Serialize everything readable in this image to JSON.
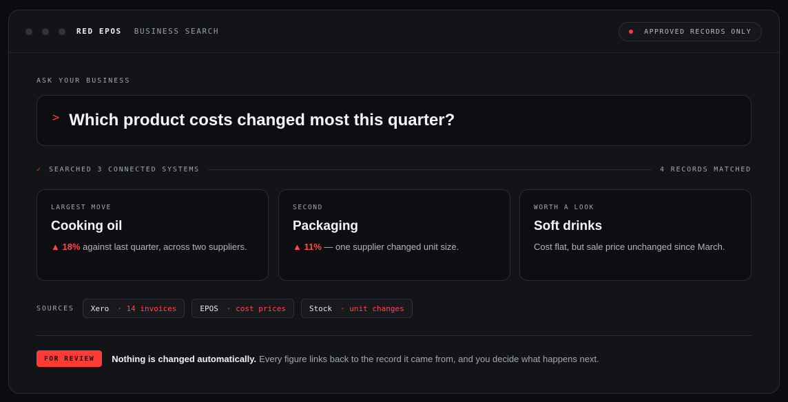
{
  "titlebar": {
    "brand": "RED EPOS",
    "subtitle": "BUSINESS SEARCH",
    "filter_label": "APPROVED RECORDS ONLY"
  },
  "query": {
    "section_label": "ASK YOUR BUSINESS",
    "prompt_glyph": ">",
    "text": "Which product costs changed most this quarter?"
  },
  "status": {
    "check_glyph": "✓",
    "searched": "SEARCHED 3 CONNECTED SYSTEMS",
    "matched": "4 RECORDS MATCHED"
  },
  "cards": [
    {
      "eyebrow": "LARGEST MOVE",
      "title": "Cooking oil",
      "delta": "▲ 18%",
      "body": " against last quarter, across two suppliers."
    },
    {
      "eyebrow": "SECOND",
      "title": "Packaging",
      "delta": "▲ 11%",
      "body": " — one supplier changed unit size."
    },
    {
      "eyebrow": "WORTH A LOOK",
      "title": "Soft drinks",
      "delta": "",
      "body": "Cost flat, but sale price unchanged since March."
    }
  ],
  "sources": {
    "label": "SOURCES",
    "chips": [
      {
        "name": "Xero",
        "meta": "· 14 invoices"
      },
      {
        "name": "EPOS",
        "meta": "· cost prices"
      },
      {
        "name": "Stock",
        "meta": "· unit changes"
      }
    ]
  },
  "footer": {
    "badge": "FOR REVIEW",
    "strong": "Nothing is changed automatically.",
    "text": "Every figure links back to the record it came from, and you decide what happens next."
  },
  "colors": {
    "accent": "#ff3b35",
    "background": "#0b0c0f",
    "panel": "#121418"
  },
  "icons": {
    "window_dots": "window-control-dot",
    "prompt": "chevron-right-icon",
    "check": "check-icon",
    "status_dot": "status-dot-icon"
  }
}
